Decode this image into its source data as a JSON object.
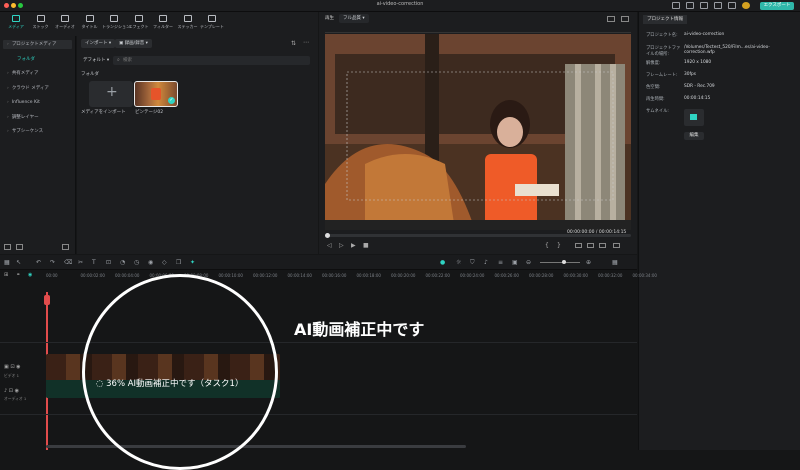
{
  "window": {
    "title": "ai-video-correction",
    "export_label": "エクスポート"
  },
  "toolbar": {
    "tabs": [
      {
        "label": "メディア",
        "icon": "media-icon",
        "active": true
      },
      {
        "label": "ストック",
        "icon": "stock-icon"
      },
      {
        "label": "オーディオ",
        "icon": "music-icon"
      },
      {
        "label": "タイトル",
        "icon": "title-icon"
      },
      {
        "label": "トランジション",
        "icon": "transition-icon"
      },
      {
        "label": "エフェクト",
        "icon": "effect-icon"
      },
      {
        "label": "フィルター",
        "icon": "filter-icon"
      },
      {
        "label": "ステッカー",
        "icon": "sticker-icon"
      },
      {
        "label": "テンプレート",
        "icon": "template-icon"
      }
    ]
  },
  "sidebar": {
    "items": [
      {
        "label": "プロジェクトメディア",
        "highlight": true
      },
      {
        "label": "フォルダ",
        "highlight": false,
        "accent": true
      },
      {
        "label": "共有メディア"
      },
      {
        "label": "クラウド メディア"
      },
      {
        "label": "Influence Kit"
      },
      {
        "label": "調整レイヤー"
      },
      {
        "label": "サブシーケンス"
      }
    ]
  },
  "media": {
    "import_label": "インポート",
    "record_label": "録画/録音",
    "default_label": "デフォルト",
    "search_placeholder": "検索",
    "folder_label": "フォルダ",
    "import_tile_label": "メディアをインポート",
    "clip_tile_label": "ピンテージ02"
  },
  "preview": {
    "player_label": "再生",
    "quality_label": "フル品質",
    "time_current": "00:00:00:00",
    "time_total": "00:00:14:15"
  },
  "properties": {
    "tab_label": "プロジェクト情報",
    "rows": [
      {
        "key": "プロジェクト名:",
        "value": "ai-video-correction"
      },
      {
        "key": "プロジェクトファイルの場所:",
        "value": "/Volumes/Tectest_520/Film...es/ai-video-correction.wfp"
      },
      {
        "key": "解像度:",
        "value": "1920 x 1080"
      },
      {
        "key": "フレームレート:",
        "value": "30fps"
      },
      {
        "key": "色空間:",
        "value": "SDR - Rec.709"
      },
      {
        "key": "再生時間:",
        "value": "00:00:14:15"
      },
      {
        "key": "サムネイル:",
        "value": ""
      }
    ],
    "edit_label": "編集"
  },
  "timeline": {
    "ruler": [
      "00:00",
      "00:00:02:00",
      "00:00:04:00",
      "00:00:06:00",
      "00:00:08:00",
      "00:00:10:00",
      "00:00:12:00",
      "00:00:14:00",
      "00:00:16:00",
      "00:00:18:00",
      "00:00:20:00",
      "00:00:22:00",
      "00:00:24:00",
      "00:00:26:00",
      "00:00:28:00",
      "00:00:30:00",
      "00:00:32:00",
      "00:00:34:00"
    ],
    "video_track_label": "ビデオ 1",
    "audio_track_label": "オーディオ 1",
    "progress_text": "36% AI動画補正中です（タスク1）"
  },
  "overlay": {
    "caption": "AI動画補正中です"
  },
  "colors": {
    "accent": "#2fd4c3",
    "export": "#2fb7a9",
    "panel": "#1c1d1f"
  }
}
